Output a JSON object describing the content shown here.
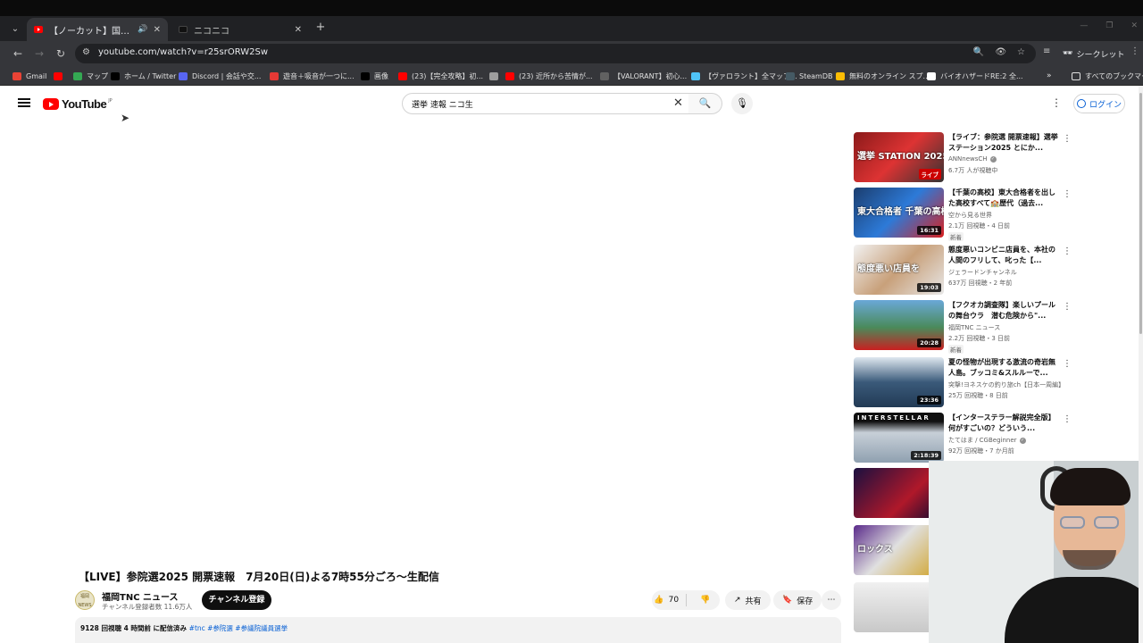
{
  "browser": {
    "tabs": [
      {
        "title": "【ノーカット】国民民主・玉木雄",
        "active": true,
        "audio": true
      },
      {
        "title": "ニコニコ",
        "active": false,
        "audio": false
      }
    ],
    "url": "youtube.com/watch?v=r25srORW2Sw",
    "incognito_label": "シークレット",
    "bookmarks": [
      {
        "label": "Gmail",
        "color": "#ea4335"
      },
      {
        "label": "",
        "color": "#ff0000"
      },
      {
        "label": "マップ",
        "color": "#34a853"
      },
      {
        "label": "ホーム / Twitter",
        "color": "#000000"
      },
      {
        "label": "Discord | 会話や交...",
        "color": "#5865f2"
      },
      {
        "label": "遊音＋吸音が一つに...",
        "color": "#e53935"
      },
      {
        "label": "画像",
        "color": "#000000"
      },
      {
        "label": "(23)【完全攻略】初...",
        "color": "#ff0000"
      },
      {
        "label": "",
        "color": "#9e9e9e"
      },
      {
        "label": "(23) 近所から苦情が...",
        "color": "#ff0000"
      },
      {
        "label": "【VALORANT】初心...",
        "color": "#616161"
      },
      {
        "label": "【ヴァロラント】全マップ...",
        "color": "#4fc3f7"
      },
      {
        "label": "SteamDB",
        "color": "#455a64"
      },
      {
        "label": "無料のオンライン スプ...",
        "color": "#fbbc04"
      },
      {
        "label": "バイオハザードRE:2 全...",
        "color": "#ffffff"
      }
    ],
    "all_bookmarks_label": "すべてのブックマーク"
  },
  "youtube": {
    "logo_text": "YouTube",
    "logo_jp": "JP",
    "search": {
      "value": "選挙 速報 ニコ生"
    },
    "login_label": "ログイン",
    "video": {
      "title": "【LIVE】参院選2025 開票速報　7月20日(日)よる7時55分ごろ〜生配信",
      "channel": "福岡TNC ニュース",
      "subscribers": "チャンネル登録者数 11.6万人",
      "avatar_text": "福岡 NEWS",
      "subscribe_label": "チャンネル登録",
      "likes": "70",
      "share_label": "共有",
      "save_label": "保存",
      "description_meta": "9128 回視聴  4 時間前 に配信済み  ",
      "description_tags": "#tnc #参院選 #参議院議員選挙"
    },
    "recommendations": [
      {
        "title": "【ライブ：参院選 開票速報】選挙ステーション2025 とにか...",
        "channel": "ANNnewsCH",
        "verified": true,
        "meta": "6.7万 人が視聴中",
        "badge": "ライブ",
        "is_live": true,
        "is_new": false,
        "thumb_text": "選挙 STATION 2025"
      },
      {
        "title": "【千葉の高校】東大合格者を出した高校すべて🏫歴代（過去...",
        "channel": "空から見る世界",
        "verified": false,
        "meta": "2.1万 回視聴・4 日前",
        "badge": "16:31",
        "is_live": false,
        "is_new": true,
        "new_label": "新着",
        "thumb_text": "東大合格者 千葉の高校"
      },
      {
        "title": "態度悪いコンビニ店員を、本社の人間のフリして、叱った【...",
        "channel": "ジェラードンチャンネル",
        "verified": false,
        "meta": "637万 回視聴・2 年前",
        "badge": "19:03",
        "is_live": false,
        "is_new": false,
        "thumb_text": "態度悪い店員を"
      },
      {
        "title": "【フクオカ調査隊】楽しいプールの舞台ウラ　潜む危険から\"...",
        "channel": "福岡TNC ニュース",
        "verified": false,
        "meta": "2.2万 回視聴・3 日前",
        "badge": "20:28",
        "is_live": false,
        "is_new": true,
        "new_label": "新着",
        "thumb_text": ""
      },
      {
        "title": "夏の怪物が出現する激流の奇岩無人島。ブッコミ&スルルーで...",
        "channel": "突撃!ヨネスケの釣り旅ch【日本一周編】",
        "verified": false,
        "meta": "25万 回視聴・8 日前",
        "badge": "23:36",
        "is_live": false,
        "is_new": false,
        "thumb_text": ""
      },
      {
        "title": "【インターステラー解説完全版】何がすごいの？どういう...",
        "channel": "たてはま / CGBeginner",
        "verified": true,
        "meta": "92万 回視聴・7 か月前",
        "badge": "2:18:39",
        "is_live": false,
        "is_new": false,
        "thumb_text": "INTERSTELLAR"
      },
      {
        "title": "",
        "channel": "",
        "verified": false,
        "meta": "",
        "badge": "",
        "is_live": false,
        "is_new": false,
        "thumb_text": ""
      },
      {
        "title": "",
        "channel": "",
        "verified": false,
        "meta": "",
        "badge": "",
        "is_live": false,
        "is_new": false,
        "thumb_text": "ロックス"
      },
      {
        "title": "",
        "channel": "",
        "verified": false,
        "meta": "",
        "badge": "",
        "is_live": false,
        "is_new": false,
        "thumb_text": ""
      }
    ]
  },
  "colors": {
    "accent_red": "#ff0000",
    "link_blue": "#065fd4",
    "chrome_dark": "#35363a"
  }
}
